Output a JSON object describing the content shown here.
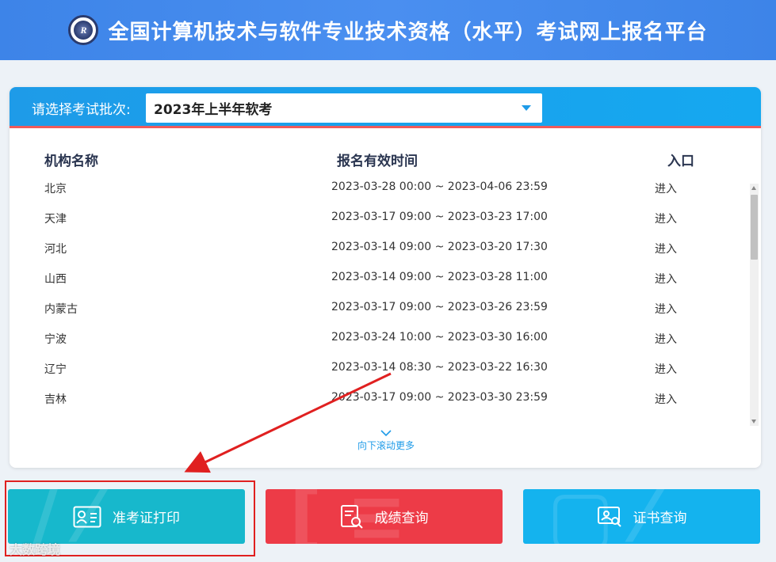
{
  "header": {
    "title": "全国计算机技术与软件专业技术资格（水平）考试网上报名平台"
  },
  "batch": {
    "label": "请选择考试批次:",
    "selected": "2023年上半年软考"
  },
  "table": {
    "headers": {
      "name": "机构名称",
      "time": "报名有效时间",
      "entry": "入口"
    },
    "rows": [
      {
        "name": "北京",
        "time": "2023-03-28 00:00 ~ 2023-04-06 23:59",
        "entry": "进入"
      },
      {
        "name": "天津",
        "time": "2023-03-17 09:00 ~ 2023-03-23 17:00",
        "entry": "进入"
      },
      {
        "name": "河北",
        "time": "2023-03-14 09:00 ~ 2023-03-20 17:30",
        "entry": "进入"
      },
      {
        "name": "山西",
        "time": "2023-03-14 09:00 ~ 2023-03-28 11:00",
        "entry": "进入"
      },
      {
        "name": "内蒙古",
        "time": "2023-03-17 09:00 ~ 2023-03-26 23:59",
        "entry": "进入"
      },
      {
        "name": "宁波",
        "time": "2023-03-24 10:00 ~ 2023-03-30 16:00",
        "entry": "进入"
      },
      {
        "name": "辽宁",
        "time": "2023-03-14 08:30 ~ 2023-03-22 16:30",
        "entry": "进入"
      },
      {
        "name": "吉林",
        "time": "2023-03-17 09:00 ~ 2023-03-30 23:59",
        "entry": "进入"
      }
    ]
  },
  "more": {
    "label": "向下滚动更多"
  },
  "buttons": {
    "ticket": "准考证打印",
    "score": "成绩查询",
    "cert": "证书查询"
  },
  "watermark": "大数跨境",
  "colors": {
    "header_bg": "#3d84e8",
    "panel_head_bg": "#1e9be8",
    "accent_red": "#ef5b5b",
    "ticket_btn": "#17b8cc",
    "score_btn": "#ed3b47",
    "cert_btn": "#14b3ee",
    "annotation": "#e02020"
  },
  "icons": {
    "logo": "ruankao-logo-icon",
    "caret": "caret-down-icon",
    "more": "chevron-down-icon",
    "ticket": "id-card-icon",
    "score": "document-search-icon",
    "cert": "certificate-search-icon"
  }
}
